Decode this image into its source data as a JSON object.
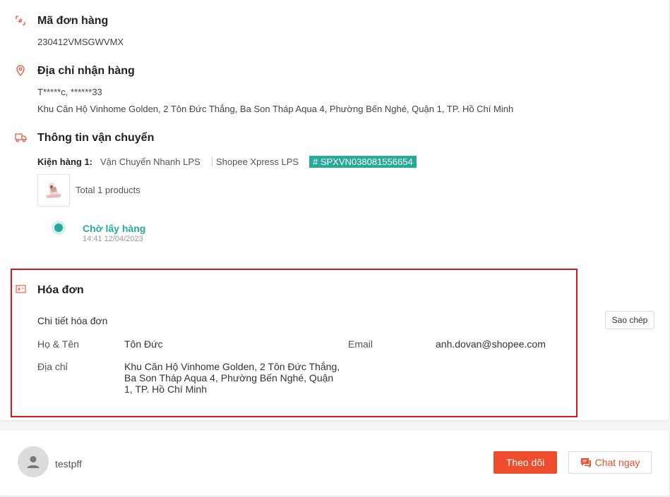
{
  "order_id": {
    "title": "Mã đơn hàng",
    "value": "230412VMSGWVMX"
  },
  "address": {
    "title": "Địa chỉ nhận hàng",
    "name_phone": "T*****c, ******33",
    "full": "Khu Căn Hộ Vinhome Golden, 2 Tôn Đức Thắng, Ba Son Tháp Aqua 4, Phường Bến Nghé, Quận 1, TP. Hồ Chí Minh"
  },
  "shipping": {
    "title": "Thông tin vận chuyển",
    "package_label": "Kiện hàng 1:",
    "carrier": "Vận Chuyển Nhanh LPS",
    "provider": "Shopee Xpress LPS",
    "tracking": "# SPXVN038081556654",
    "products": "Total 1 products",
    "status": "Chờ lấy hàng",
    "status_time": "14:41 12/04/2023"
  },
  "invoice": {
    "title": "Hóa đơn",
    "details_label": "Chi tiết hóa đơn",
    "copy_label": "Sao chép",
    "name_label": "Họ & Tên",
    "name_value": "Tôn Đức",
    "email_label": "Email",
    "email_value": "anh.dovan@shopee.com",
    "address_label": "Địa chỉ",
    "address_value": "Khu Căn Hộ Vinhome Golden, 2 Tôn Đức Thắng, Ba Son Tháp Aqua 4, Phường Bến Nghé, Quận 1, TP. Hồ Chí Minh"
  },
  "buyer": {
    "username": "testpff",
    "follow_label": "Theo dõi",
    "chat_label": "Chat ngay"
  },
  "colors": {
    "accent": "#ee4d2d",
    "teal": "#26aa99",
    "highlight": "#d8161b"
  }
}
